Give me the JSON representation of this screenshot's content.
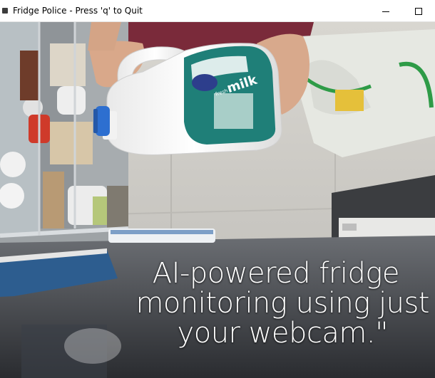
{
  "window": {
    "title": "Fridge Police - Press 'q' to Quit",
    "controls": {
      "minimize_icon": "minimize-icon",
      "maximize_icon": "maximize-icon"
    }
  },
  "webcam_view": {
    "caption": {
      "line1": "AI-powered fridge",
      "line2": "monitoring using just",
      "line3": "your webcam.\""
    },
    "milk_label": {
      "brand": "milk",
      "small_text": "fresh"
    }
  },
  "colors": {
    "titlebar_bg": "#ffffff",
    "caption_text": "#ffffff",
    "milk_label_teal": "#1f7f78",
    "bottle_cap_blue": "#2d6fd0"
  }
}
